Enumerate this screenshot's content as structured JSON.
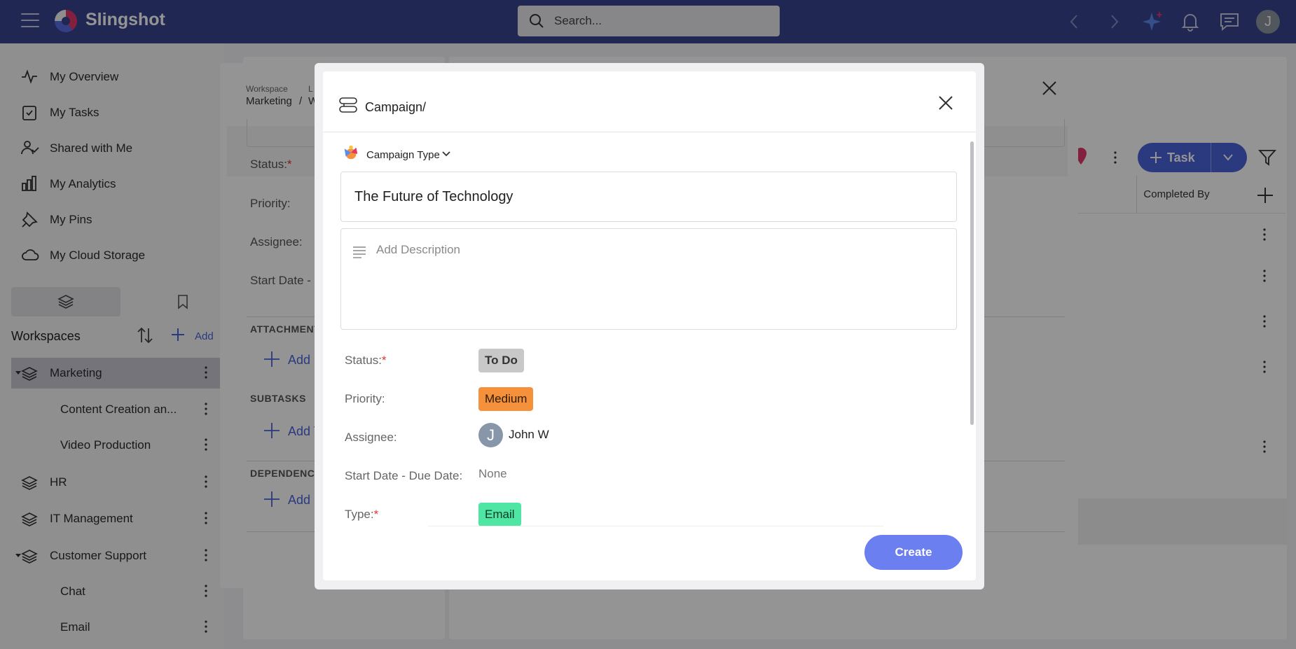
{
  "app": {
    "brand": "Slingshot"
  },
  "search": {
    "placeholder": "Search..."
  },
  "user": {
    "initial": "J"
  },
  "sidebar": {
    "nav": [
      {
        "label": "My Overview",
        "icon": "activity-icon"
      },
      {
        "label": "My Tasks",
        "icon": "task-check-icon"
      },
      {
        "label": "Shared with Me",
        "icon": "users-icon"
      },
      {
        "label": "My Analytics",
        "icon": "bar-chart-icon"
      },
      {
        "label": "My Pins",
        "icon": "pin-icon"
      },
      {
        "label": "My Cloud Storage",
        "icon": "cloud-icon"
      }
    ],
    "workspaces_title": "Workspaces",
    "add_label": "Add",
    "workspaces": [
      {
        "label": "Marketing"
      },
      {
        "label": "Content Creation an..."
      },
      {
        "label": "Video Production"
      },
      {
        "label": "HR"
      },
      {
        "label": "IT Management"
      },
      {
        "label": "Customer Support"
      },
      {
        "label": "Chat"
      },
      {
        "label": "Email"
      }
    ]
  },
  "background": {
    "task_button": "Task",
    "column_header": "Completed By"
  },
  "task_modal": {
    "crumb_small": "Workspace",
    "crumb_small2": "L",
    "crumb_workspace": "Marketing",
    "crumb_sep": "/",
    "crumb_next": "W",
    "fields": {
      "status": "Status:",
      "priority": "Priority:",
      "assignee": "Assignee:",
      "start_date": "Start Date -"
    },
    "req_mark": "*",
    "sections": {
      "attachments": "ATTACHMENT",
      "subtasks": "SUBTASKS",
      "dependencies": "DEPENDENCI"
    },
    "add_short": "Add",
    "add_t": "Add T"
  },
  "modal": {
    "title": "Campaign/",
    "type_selector": "Campaign Type",
    "name_value": "The Future of Technology",
    "description_placeholder": "Add Description",
    "fields": {
      "status_label": "Status:",
      "status_value": "To Do",
      "priority_label": "Priority:",
      "priority_value": "Medium",
      "assignee_label": "Assignee:",
      "assignee_initial": "J",
      "assignee_name": "John W",
      "dates_label": "Start Date - Due Date:",
      "dates_value": "None",
      "type_label": "Type:",
      "type_value": "Email"
    },
    "required_mark": "*",
    "create_button": "Create"
  },
  "colors": {
    "topbar": "#3a4490",
    "accent": "#4a63d9",
    "todo": "#c8c8c8",
    "medium": "#f5913b",
    "email": "#4fe6a3",
    "create": "#6b7ff0"
  }
}
